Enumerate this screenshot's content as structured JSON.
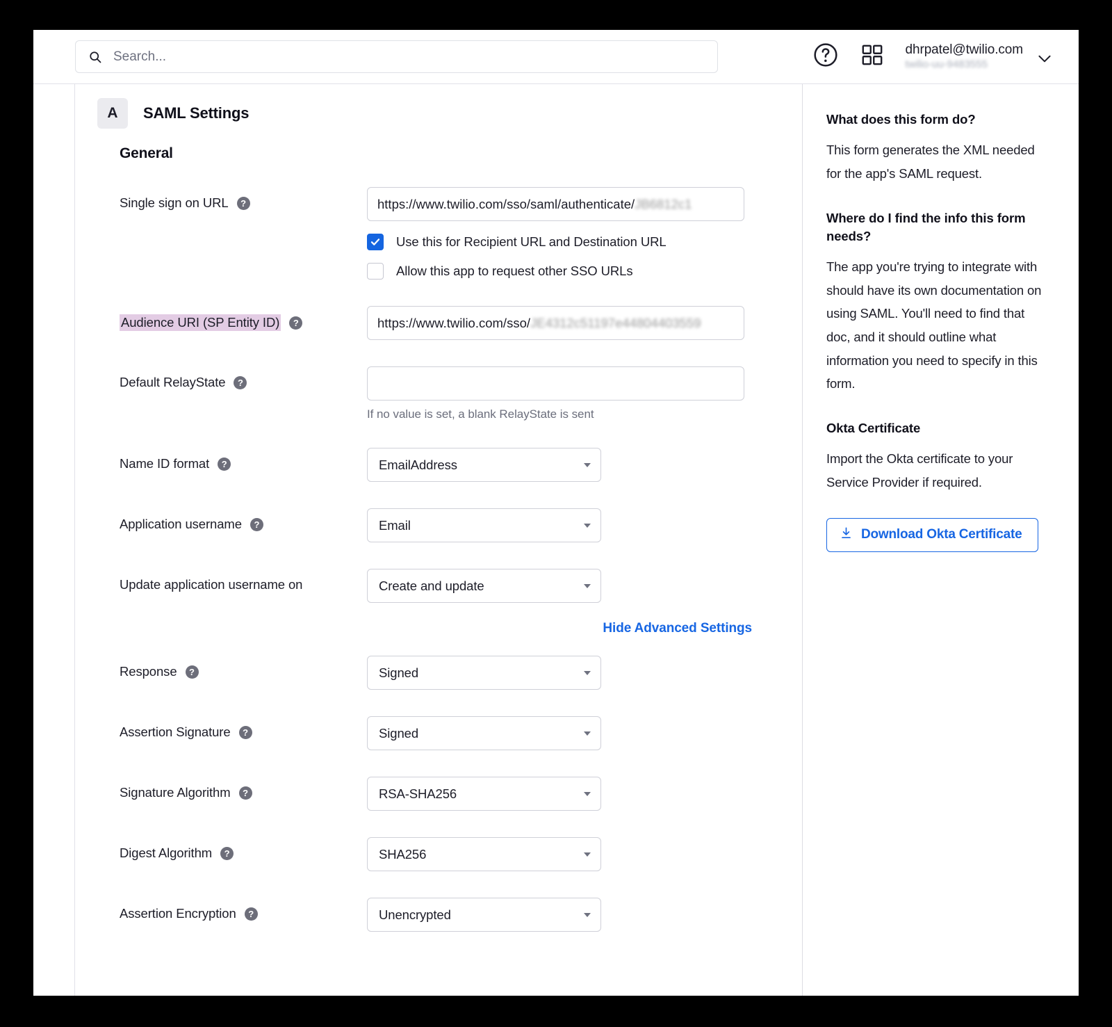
{
  "topbar": {
    "search_placeholder": "Search...",
    "search_value": "",
    "search_icon": "search-icon",
    "help_icon": "question-circle-icon",
    "apps_icon": "apps-grid-icon",
    "user_email": "dhrpatel@twilio.com",
    "user_org": "twilio-uu-9483555",
    "caret_icon": "chevron-down-icon"
  },
  "app": {
    "badge_letter": "A",
    "title": "SAML Settings",
    "section_title": "General"
  },
  "form": {
    "sso_url": {
      "label": "Single sign on URL",
      "help_icon": "help-icon",
      "value_visible": "https://www.twilio.com/sso/saml/authenticate/",
      "value_redacted": "JB6812c1",
      "checkbox_recipient": {
        "label": "Use this for Recipient URL and Destination URL",
        "checked": true
      },
      "checkbox_other_sso": {
        "label": "Allow this app to request other SSO URLs",
        "checked": false
      }
    },
    "audience_uri": {
      "label": "Audience URI (SP Entity ID)",
      "highlighted": true,
      "help_icon": "help-icon",
      "value_visible": "https://www.twilio.com/sso/",
      "value_redacted": "JE4312c51197e44804403559"
    },
    "relay_state": {
      "label": "Default RelayState",
      "help_icon": "help-icon",
      "value": "",
      "hint": "If no value is set, a blank RelayState is sent"
    },
    "name_id_format": {
      "label": "Name ID format",
      "help_icon": "help-icon",
      "value": "EmailAddress"
    },
    "application_username": {
      "label": "Application username",
      "help_icon": "help-icon",
      "value": "Email"
    },
    "update_username_on": {
      "label": "Update application username on",
      "help_icon": null,
      "value": "Create and update"
    },
    "advanced_toggle": "Hide Advanced Settings",
    "response": {
      "label": "Response",
      "help_icon": "help-icon",
      "value": "Signed"
    },
    "assertion_signature": {
      "label": "Assertion Signature",
      "help_icon": "help-icon",
      "value": "Signed"
    },
    "signature_algorithm": {
      "label": "Signature Algorithm",
      "help_icon": "help-icon",
      "value": "RSA-SHA256"
    },
    "digest_algorithm": {
      "label": "Digest Algorithm",
      "help_icon": "help-icon",
      "value": "SHA256"
    },
    "assertion_encryption": {
      "label": "Assertion Encryption",
      "help_icon": "help-icon",
      "value": "Unencrypted"
    }
  },
  "aside": {
    "q1_heading": "What does this form do?",
    "q1_body": "This form generates the XML needed for the app's SAML request.",
    "q2_heading": "Where do I find the info this form needs?",
    "q2_body": "The app you're trying to integrate with should have its own documentation on using SAML. You'll need to find that doc, and it should outline what information you need to specify in this form.",
    "cert_heading": "Okta Certificate",
    "cert_body": "Import the Okta certificate to your Service Provider if required.",
    "download_label": "Download Okta Certificate",
    "download_icon": "download-icon"
  },
  "colors": {
    "accent_blue": "#1766e3",
    "checkbox_blue": "#1565e0",
    "highlight_pink": "#e3cce4",
    "text_primary": "#1d1d28",
    "text_muted": "#6b6e7c",
    "border": "#cfd0d8"
  }
}
